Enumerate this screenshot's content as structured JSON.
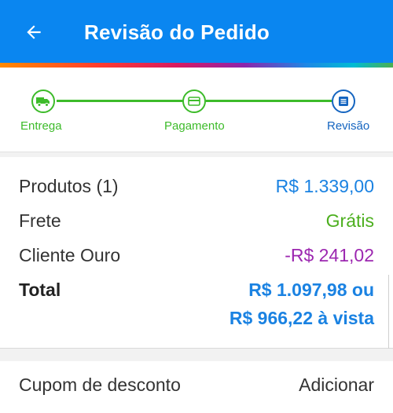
{
  "header": {
    "title": "Revisão do Pedido",
    "back_icon": "arrow-left-icon",
    "background_color": "#0a86f0"
  },
  "steps": [
    {
      "label": "Entrega",
      "icon": "truck-icon",
      "state": "completed",
      "color": "#3dbb2a"
    },
    {
      "label": "Pagamento",
      "icon": "credit-card-icon",
      "state": "completed",
      "color": "#3dbb2a"
    },
    {
      "label": "Revisão",
      "icon": "document-icon",
      "state": "current",
      "color": "#1565c0"
    }
  ],
  "summary": {
    "products_label": "Produtos (1)",
    "products_value": "R$ 1.339,00",
    "shipping_label": "Frete",
    "shipping_value": "Grátis",
    "gold_label": "Cliente Ouro",
    "gold_value": "-R$ 241,02",
    "total_label": "Total",
    "total_value_line1": "R$ 1.097,98 ou",
    "total_value_line2": "R$ 966,22 à vista"
  },
  "coupon": {
    "label": "Cupom de desconto",
    "action": "Adicionar"
  }
}
